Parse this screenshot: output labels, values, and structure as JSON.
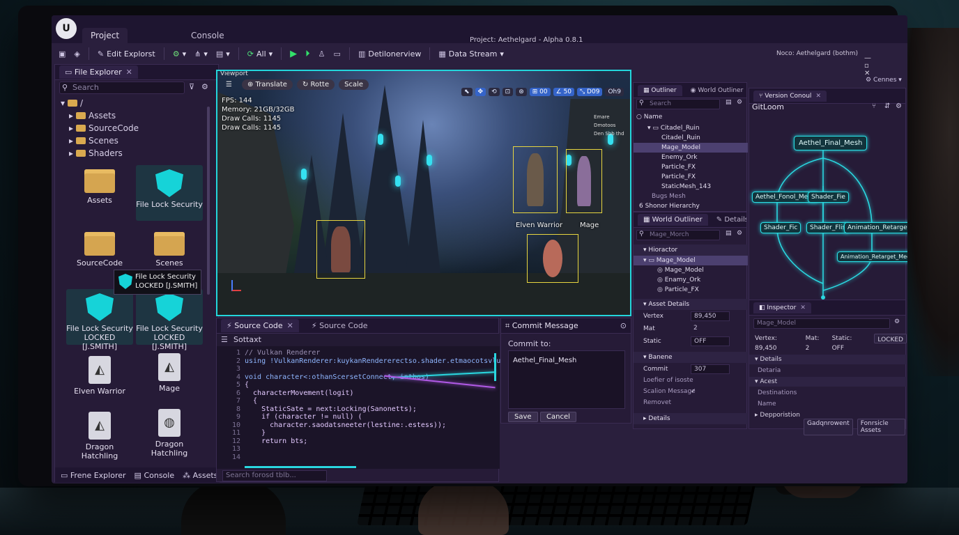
{
  "window": {
    "tabs": [
      "Project",
      "Console"
    ],
    "title": "Project: Aethelgard - Alpha 0.8.1",
    "user": "Noco: Aethelgard (bothm)"
  },
  "toolbar": {
    "edit_explorer": "Edit Explorst",
    "all": "All",
    "detail_overview": "Detilonerview",
    "data_stream": "Data Stream"
  },
  "file_explorer": {
    "tab": "File Explorer",
    "search_placeholder": "Search",
    "root": "/",
    "tree": [
      "Assets",
      "SourceCode",
      "Scenes",
      "Shaders"
    ],
    "tiles": {
      "assets": "Assets",
      "file_lock_1": "File Lock Security",
      "sourcecode": "SourceCode",
      "scenes": "Scenes",
      "file_lock_2": "File Lock Security",
      "file_lock_2_sub": "LOCKED [J.SMITH]",
      "file_lock_3": "File Lock Security",
      "file_lock_3_sub": "LOCKED [J.SMITH]",
      "elven_warrior": "Elven Warrior",
      "mage": "Mage",
      "dragon_hatchling_1": "Dragon Hatchling",
      "dragon_hatchling_2": "Dragon Hatchling"
    },
    "tooltip_title": "File Lock Security",
    "tooltip_sub": "LOCKED [J.SMITH]",
    "bottom_tabs": [
      "Frene Explorer",
      "Console",
      "Assets"
    ]
  },
  "viewport": {
    "title": "Viewport",
    "tools": [
      "Translate",
      "Rotte",
      "Scale"
    ],
    "stats": [
      "FPS: 144",
      "Memory: 21GB/32GB",
      "Draw Calls: 1145",
      "Draw Calls: 1145"
    ],
    "right_chips": [
      "00",
      "50",
      "D09",
      "Oh9"
    ],
    "env": [
      "Emare Dmotoos",
      "Den Sbb thd"
    ],
    "labels": [
      "Elven Warrior",
      "Mage"
    ]
  },
  "source_code": {
    "tabs": [
      "Source Code",
      "Source Code"
    ],
    "file": "Sottaxt",
    "line_numbers": [
      "1",
      "2",
      "3",
      "4",
      "5",
      "6",
      "7",
      "8",
      "9",
      "10",
      "11",
      "12",
      "13",
      "14"
    ],
    "lines": [
      "// Vulkan Renderer",
      "using !VulkanRenderer:kuykanRendererectso.shader.etmaocotsvlukaoRovonbs",
      "",
      "void character<:othanScersetConnect, intbos)",
      "{",
      "  characterMovement(logit)",
      "  {",
      "    StaticSate = next:Locking(Sanonetts);",
      "    if (character != null) (",
      "      character.saodatsneeter(lestine:.estess));",
      "    }",
      "    return bts;",
      "",
      ""
    ],
    "search_placeholder": "Search forosd tblb..."
  },
  "commit": {
    "title": "Commit Message",
    "label": "Commit to:",
    "value": "Aethel_Final_Mesh",
    "save": "Save",
    "cancel": "Cancel"
  },
  "outliner": {
    "tabs": [
      "Outliner",
      "World Outliner"
    ],
    "search_placeholder": "Search",
    "col": "Name",
    "rows": [
      "Citadel_Ruin",
      "Citadel_Ruin",
      "Mage_Model",
      "Enemy_Ork",
      "Particle_FX",
      "Particle_FX",
      "StaticMesh_143",
      "Bugs Mesh"
    ],
    "footer": "6 Shonor Hierarchy"
  },
  "world": {
    "tabs": [
      "World Outliner",
      "Details"
    ],
    "search_value": "Mage_Morch",
    "hierarchy": "Hioractor",
    "rows": [
      "Mage_Model",
      "Mage_Model",
      "Enamy_Ork",
      "Particle_FX"
    ],
    "asset_details": "Asset Details",
    "props": [
      {
        "k": "Vertex",
        "v": "89,450"
      },
      {
        "k": "Mat",
        "v": "2"
      },
      {
        "k": "Static",
        "v": "OFF"
      }
    ],
    "banene": "Banene",
    "props2": [
      {
        "k": "Commit",
        "v": "307"
      },
      {
        "k": "Loefier of isoste",
        "v": ""
      },
      {
        "k": "Scalion Message",
        "v": "✓"
      },
      {
        "k": "Removet",
        "v": ""
      }
    ],
    "details": "Details"
  },
  "version_control": {
    "tab": "Version Conoul",
    "title": "GitLoom",
    "nodes": [
      "Aethel_Final_Mesh",
      "Aethel_Fonol_Mesh",
      "Shader_Fie",
      "Shader_Fic",
      "Shader_Flis",
      "Animation_Retarget",
      "Animation_Retarget_Mech"
    ],
    "corner": "Cennes"
  },
  "inspector": {
    "tab": "Inspector",
    "name": "Mage_Model",
    "vertex": "Vertex: 89,450",
    "mat": "Mat: 2",
    "static": "Static: OFF",
    "locked": "LOCKED",
    "rows": [
      "Details",
      "Detaria",
      "Acest",
      "Destinations",
      "Name",
      "Depporistion"
    ],
    "footer": [
      "Gadqnrowent",
      "Fonrsicle Assets"
    ]
  }
}
